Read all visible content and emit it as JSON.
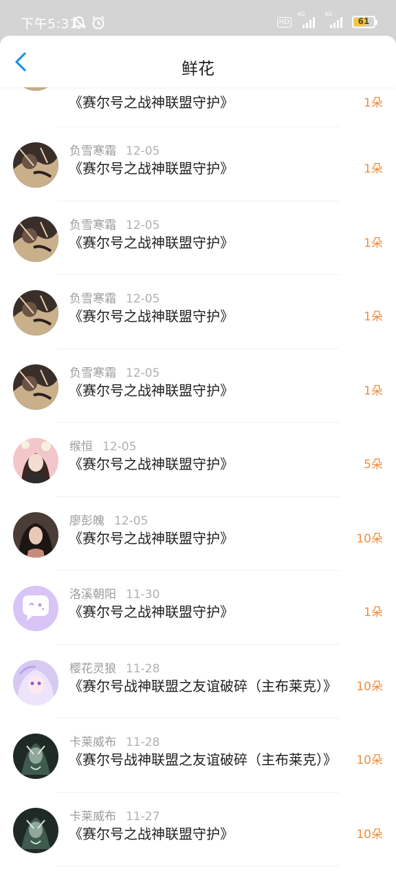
{
  "status": {
    "time": "下午5:31",
    "hd": "HD",
    "net1": "4G",
    "net2": "4G",
    "battery": "61",
    "battery_level": 0.61
  },
  "header": {
    "title": "鲜花"
  },
  "colors": {
    "accent": "#1e90e0",
    "amount": "#f08c3a"
  },
  "items": [
    {
      "name": "",
      "date": "",
      "book": "《赛尔号之战神联盟守护》",
      "amount": "1朵",
      "avatar": "dark-anime"
    },
    {
      "name": "负雪寒霜",
      "date": "12-05",
      "book": "《赛尔号之战神联盟守护》",
      "amount": "1朵",
      "avatar": "dark-anime"
    },
    {
      "name": "负雪寒霜",
      "date": "12-05",
      "book": "《赛尔号之战神联盟守护》",
      "amount": "1朵",
      "avatar": "dark-anime"
    },
    {
      "name": "负雪寒霜",
      "date": "12-05",
      "book": "《赛尔号之战神联盟守护》",
      "amount": "1朵",
      "avatar": "dark-anime"
    },
    {
      "name": "负雪寒霜",
      "date": "12-05",
      "book": "《赛尔号之战神联盟守护》",
      "amount": "1朵",
      "avatar": "dark-anime"
    },
    {
      "name": "缑恒",
      "date": "12-05",
      "book": "《赛尔号之战神联盟守护》",
      "amount": "5朵",
      "avatar": "girl-pink"
    },
    {
      "name": "廖彭魄",
      "date": "12-05",
      "book": "《赛尔号之战神联盟守护》",
      "amount": "10朵",
      "avatar": "girl-dark"
    },
    {
      "name": "洛溪朝阳",
      "date": "11-30",
      "book": "《赛尔号之战神联盟守护》",
      "amount": "1朵",
      "avatar": "chat-bubble"
    },
    {
      "name": "樱花灵狼",
      "date": "11-28",
      "book": "《赛尔号战神联盟之友谊破碎（主布莱克）》",
      "amount": "10朵",
      "avatar": "anime-purple"
    },
    {
      "name": "卡莱威布",
      "date": "11-28",
      "book": "《赛尔号战神联盟之友谊破碎（主布莱克）》",
      "amount": "10朵",
      "avatar": "dark-green"
    },
    {
      "name": "卡莱威布",
      "date": "11-27",
      "book": "《赛尔号之战神联盟守护》",
      "amount": "10朵",
      "avatar": "dark-green"
    }
  ]
}
